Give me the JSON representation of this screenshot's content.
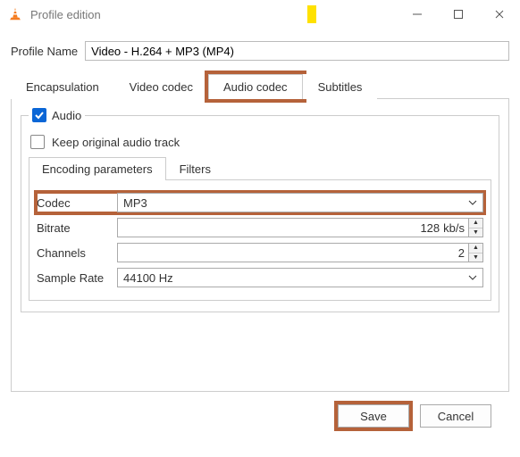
{
  "window": {
    "title": "Profile edition"
  },
  "profile": {
    "label": "Profile Name",
    "value": "Video - H.264 + MP3 (MP4)"
  },
  "tabs": {
    "encapsulation": "Encapsulation",
    "video_codec": "Video codec",
    "audio_codec": "Audio codec",
    "subtitles": "Subtitles"
  },
  "audio": {
    "checkbox_label": "Audio",
    "keep_label": "Keep original audio track",
    "subtabs": {
      "encoding": "Encoding parameters",
      "filters": "Filters"
    },
    "fields": {
      "codec_label": "Codec",
      "codec_value": "MP3",
      "bitrate_label": "Bitrate",
      "bitrate_value": "128",
      "bitrate_unit": "kb/s",
      "channels_label": "Channels",
      "channels_value": "2",
      "samplerate_label": "Sample Rate",
      "samplerate_value": "44100 Hz"
    }
  },
  "buttons": {
    "save": "Save",
    "cancel": "Cancel"
  }
}
